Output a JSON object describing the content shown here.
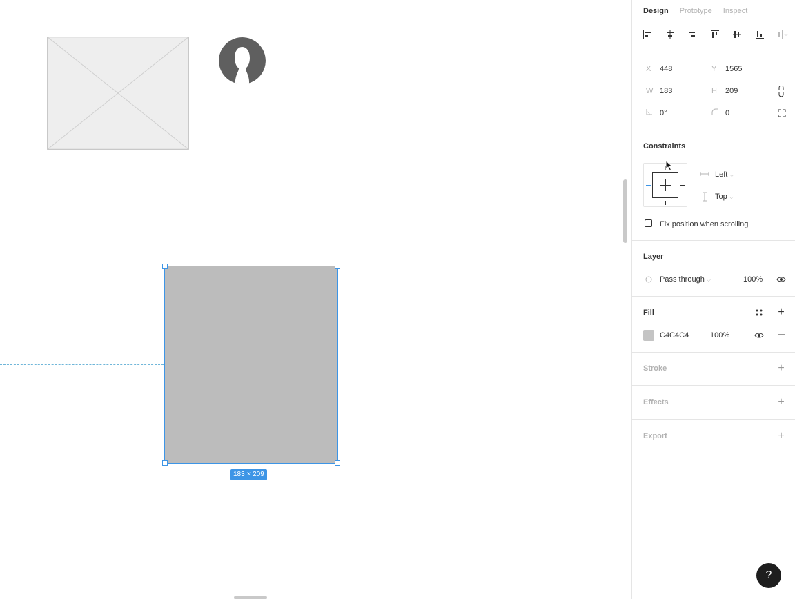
{
  "tabs": [
    {
      "label": "Design",
      "active": true
    },
    {
      "label": "Prototype",
      "active": false
    },
    {
      "label": "Inspect",
      "active": false
    }
  ],
  "align_tools": [
    "align-left-icon",
    "align-horizontal-center-icon",
    "align-right-icon",
    "align-top-icon",
    "align-vertical-center-icon",
    "align-bottom-icon",
    "distribute-icon"
  ],
  "properties": {
    "x_label": "X",
    "x": "448",
    "y_label": "Y",
    "y": "1565",
    "w_label": "W",
    "w": "183",
    "h_label": "H",
    "h": "209",
    "rotation": "0°",
    "radius": "0"
  },
  "constraints": {
    "title": "Constraints",
    "horizontal": "Left",
    "vertical": "Top",
    "fix_position_label": "Fix position when scrolling",
    "fix_position_checked": false
  },
  "layer": {
    "title": "Layer",
    "blend_mode": "Pass through",
    "opacity": "100%"
  },
  "fill": {
    "title": "Fill",
    "hex": "C4C4C4",
    "opacity": "100%",
    "color": "#c4c4c4"
  },
  "stroke": {
    "title": "Stroke"
  },
  "effects": {
    "title": "Effects"
  },
  "export": {
    "title": "Export"
  },
  "canvas": {
    "selection_size_label": "183 × 209",
    "selection_color": "#3d95e6",
    "shape_fill": "#bcbcbc"
  },
  "help_label": "?"
}
